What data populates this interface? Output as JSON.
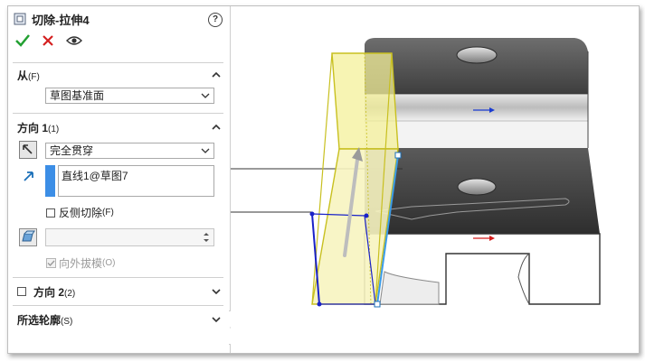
{
  "title": "切除-拉伸4",
  "help_label": "?",
  "sections": {
    "from": {
      "label": "从",
      "hint": "(F)",
      "value": "草图基准面"
    },
    "direction1": {
      "label": "方向 1",
      "hint": "(1)",
      "end_condition": "完全贯穿",
      "selection": "直线1@草图7",
      "flip_side_label": "反侧切除",
      "flip_side_hint": "(F)",
      "draft_outward_label": "向外拔模",
      "draft_outward_hint": "(O)"
    },
    "direction2": {
      "label": "方向 2",
      "hint": "(2)"
    },
    "selected_contours": {
      "label": "所选轮廓",
      "hint": "(S)"
    }
  },
  "icons": [
    "feature-cut-extrude-icon",
    "ok-check-icon",
    "cancel-x-icon",
    "preview-eye-icon",
    "flip-direction-icon",
    "direction-arrow-icon",
    "draft-icon"
  ],
  "colors": {
    "accent_blue": "#3c8ee6",
    "ok_green": "#22a032",
    "cancel_red": "#d42020",
    "preview_yellow": "#f4f09a"
  }
}
